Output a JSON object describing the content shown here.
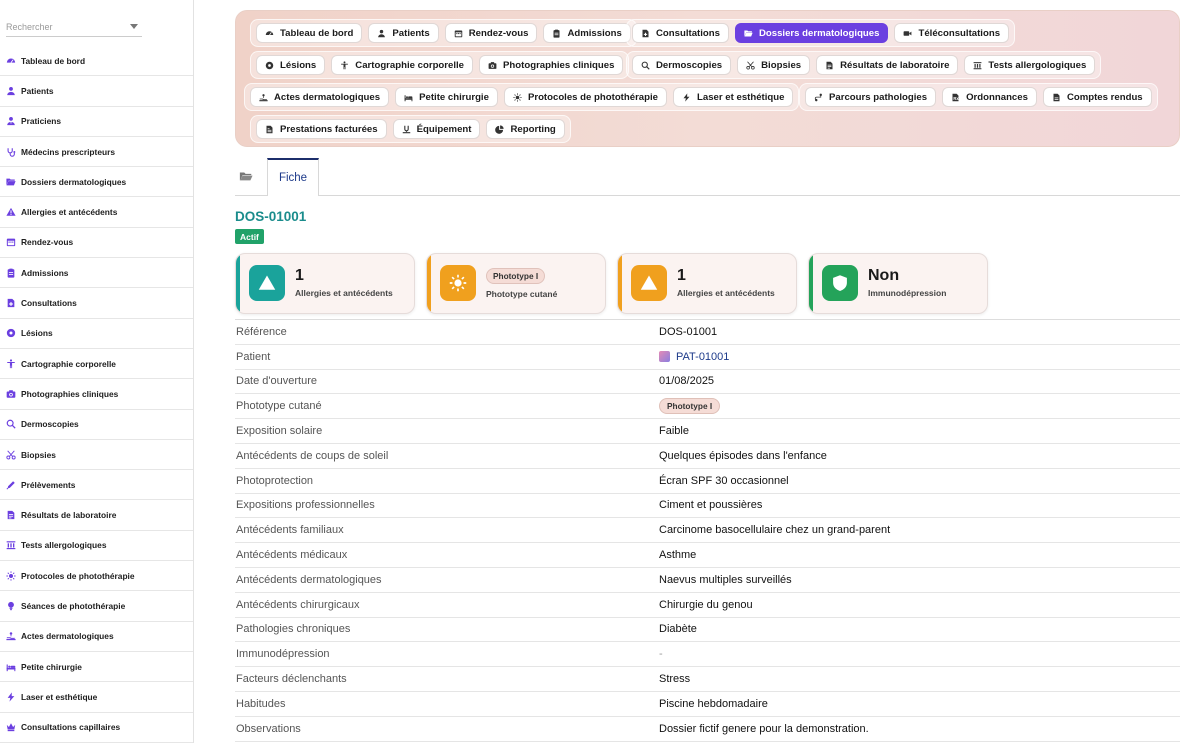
{
  "search": {
    "placeholder": "Rechercher"
  },
  "sidebar": {
    "items": [
      {
        "label": "Tableau de bord",
        "icon": "dashboard-icon"
      },
      {
        "label": "Patients",
        "icon": "user-icon"
      },
      {
        "label": "Praticiens",
        "icon": "user-tie-icon"
      },
      {
        "label": "Médecins prescripteurs",
        "icon": "stethoscope-icon"
      },
      {
        "label": "Dossiers dermatologiques",
        "icon": "folder-open-icon"
      },
      {
        "label": "Allergies et antécédents",
        "icon": "warning-icon"
      },
      {
        "label": "Rendez-vous",
        "icon": "calendar-icon"
      },
      {
        "label": "Admissions",
        "icon": "clipboard-icon"
      },
      {
        "label": "Consultations",
        "icon": "file-medical-icon"
      },
      {
        "label": "Lésions",
        "icon": "circle-dot-icon"
      },
      {
        "label": "Cartographie corporelle",
        "icon": "body-icon"
      },
      {
        "label": "Photographies cliniques",
        "icon": "camera-icon"
      },
      {
        "label": "Dermoscopies",
        "icon": "magnifier-icon"
      },
      {
        "label": "Biopsies",
        "icon": "scissors-icon"
      },
      {
        "label": "Prélèvements",
        "icon": "syringe-icon"
      },
      {
        "label": "Résultats de laboratoire",
        "icon": "lab-report-icon"
      },
      {
        "label": "Tests allergologiques",
        "icon": "allergy-test-icon"
      },
      {
        "label": "Protocoles de photothérapie",
        "icon": "sun-icon"
      },
      {
        "label": "Séances de photothérapie",
        "icon": "lightbulb-icon"
      },
      {
        "label": "Actes dermatologiques",
        "icon": "hand-treatment-icon"
      },
      {
        "label": "Petite chirurgie",
        "icon": "bed-icon"
      },
      {
        "label": "Laser et esthétique",
        "icon": "bolt-icon"
      },
      {
        "label": "Consultations capillaires",
        "icon": "crown-icon"
      }
    ]
  },
  "menu": {
    "rows": [
      {
        "groups": [
          [
            {
              "label": "Tableau de bord",
              "icon": "dashboard-icon"
            },
            {
              "label": "Patients",
              "icon": "user-icon"
            },
            {
              "label": "Rendez-vous",
              "icon": "calendar-icon"
            },
            {
              "label": "Admissions",
              "icon": "clipboard-icon"
            }
          ],
          [
            {
              "label": "Consultations",
              "icon": "file-medical-icon"
            },
            {
              "label": "Dossiers dermatologiques",
              "icon": "folder-open-icon",
              "active": true
            },
            {
              "label": "Téléconsultations",
              "icon": "video-icon"
            }
          ]
        ]
      },
      {
        "groups": [
          [
            {
              "label": "Lésions",
              "icon": "circle-dot-icon"
            },
            {
              "label": "Cartographie corporelle",
              "icon": "body-icon"
            },
            {
              "label": "Photographies cliniques",
              "icon": "camera-icon"
            }
          ],
          [
            {
              "label": "Dermoscopies",
              "icon": "magnifier-icon"
            },
            {
              "label": "Biopsies",
              "icon": "scissors-icon"
            },
            {
              "label": "Résultats de laboratoire",
              "icon": "lab-report-icon"
            },
            {
              "label": "Tests allergologiques",
              "icon": "allergy-test-icon"
            }
          ]
        ]
      },
      {
        "groups": [
          [
            {
              "label": "Actes dermatologiques",
              "icon": "hand-treatment-icon"
            },
            {
              "label": "Petite chirurgie",
              "icon": "bed-icon"
            },
            {
              "label": "Protocoles de photothérapie",
              "icon": "sun-icon"
            },
            {
              "label": "Laser et esthétique",
              "icon": "bolt-icon"
            }
          ],
          [
            {
              "label": "Parcours pathologies",
              "icon": "route-icon"
            },
            {
              "label": "Ordonnances",
              "icon": "prescription-icon"
            },
            {
              "label": "Comptes rendus",
              "icon": "document-icon"
            }
          ]
        ]
      },
      {
        "groups": [
          [
            {
              "label": "Prestations facturées",
              "icon": "invoice-icon"
            },
            {
              "label": "Équipement",
              "icon": "equipment-icon"
            },
            {
              "label": "Reporting",
              "icon": "pie-chart-icon"
            }
          ]
        ]
      }
    ]
  },
  "tabs": {
    "fiche": "Fiche"
  },
  "record": {
    "id": "DOS-01001",
    "status": "Actif"
  },
  "cards": [
    {
      "value": "1",
      "label": "Allergies et antécédents",
      "color": "#1aa39b",
      "icon": "warning-icon"
    },
    {
      "pill": "Phototype I",
      "label": "Phototype cutané",
      "color": "#f0a01e",
      "icon": "sun-icon"
    },
    {
      "value": "1",
      "label": "Allergies et antécédents",
      "color": "#f0a01e",
      "icon": "warning-icon"
    },
    {
      "value": "Non",
      "label": "Immunodépression",
      "color": "#24a35a",
      "icon": "shield-icon"
    }
  ],
  "details": [
    {
      "label": "Référence",
      "value": "DOS-01001"
    },
    {
      "label": "Patient",
      "value": "PAT-01001",
      "type": "link"
    },
    {
      "label": "Date d'ouverture",
      "value": "01/08/2025"
    },
    {
      "label": "Phototype cutané",
      "value": "Phototype I",
      "type": "pill"
    },
    {
      "label": "Exposition solaire",
      "value": "Faible"
    },
    {
      "label": "Antécédents de coups de soleil",
      "value": "Quelques épisodes dans l'enfance"
    },
    {
      "label": "Photoprotection",
      "value": "Écran SPF 30 occasionnel"
    },
    {
      "label": "Expositions professionnelles",
      "value": "Ciment et poussières"
    },
    {
      "label": "Antécédents familiaux",
      "value": "Carcinome basocellulaire chez un grand-parent"
    },
    {
      "label": "Antécédents médicaux",
      "value": "Asthme"
    },
    {
      "label": "Antécédents dermatologiques",
      "value": "Naevus multiples surveillés"
    },
    {
      "label": "Antécédents chirurgicaux",
      "value": "Chirurgie du genou"
    },
    {
      "label": "Pathologies chroniques",
      "value": "Diabète"
    },
    {
      "label": "Immunodépression",
      "value": "-",
      "type": "muted"
    },
    {
      "label": "Facteurs déclenchants",
      "value": "Stress"
    },
    {
      "label": "Habitudes",
      "value": "Piscine hebdomadaire"
    },
    {
      "label": "Observations",
      "value": "Dossier fictif genere pour la demonstration."
    }
  ],
  "colors": {
    "accent": "#6b3fe0",
    "teal": "#1a8c8c",
    "status": "#21a269",
    "sidebar_icon": "#6b3fe0"
  }
}
